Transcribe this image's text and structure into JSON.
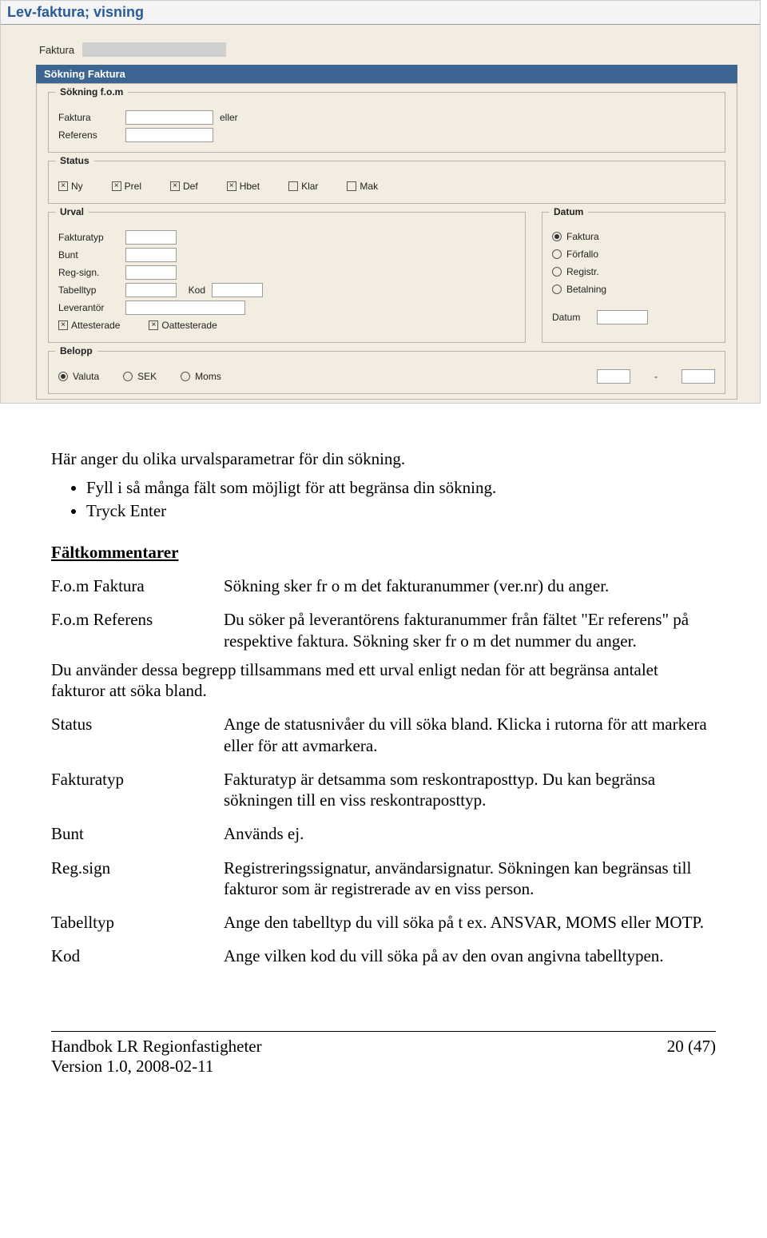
{
  "title_bar": "Lev-faktura; visning",
  "top": {
    "label": "Faktura"
  },
  "panel_title": "Sökning Faktura",
  "grp_fom": {
    "legend": "Sökning f.o.m",
    "faktura_label": "Faktura",
    "eller": "eller",
    "referens_label": "Referens"
  },
  "grp_status": {
    "legend": "Status",
    "items": [
      {
        "label": "Ny",
        "checked": true
      },
      {
        "label": "Prel",
        "checked": true
      },
      {
        "label": "Def",
        "checked": true
      },
      {
        "label": "Hbet",
        "checked": true
      },
      {
        "label": "Klar",
        "checked": false
      },
      {
        "label": "Mak",
        "checked": false
      }
    ]
  },
  "grp_urval": {
    "legend": "Urval",
    "fakturatyp": "Fakturatyp",
    "bunt": "Bunt",
    "regsign": "Reg-sign.",
    "tabelltyp": "Tabelltyp",
    "kod": "Kod",
    "leverantor": "Leverantör",
    "attesterade": {
      "label": "Attesterade",
      "checked": true
    },
    "oattesterade": {
      "label": "Oattesterade",
      "checked": true
    }
  },
  "grp_datum": {
    "legend": "Datum",
    "options": [
      {
        "label": "Faktura",
        "checked": true
      },
      {
        "label": "Förfallo",
        "checked": false
      },
      {
        "label": "Registr.",
        "checked": false
      },
      {
        "label": "Betalning",
        "checked": false
      }
    ],
    "datum_label": "Datum"
  },
  "grp_belopp": {
    "legend": "Belopp",
    "options": [
      {
        "label": "Valuta",
        "checked": true
      },
      {
        "label": "SEK",
        "checked": false
      },
      {
        "label": "Moms",
        "checked": false
      }
    ],
    "dash": "-"
  },
  "doc": {
    "intro": "Här anger du olika urvalsparametrar för din sökning.",
    "bullets": [
      "Fyll i så många fält som möjligt för att begränsa din sökning.",
      "Tryck Enter"
    ],
    "section": "Fältkommentarer",
    "rows1": [
      {
        "k": "F.o.m Faktura",
        "v": "Sökning sker fr o m det fakturanummer (ver.nr) du anger."
      },
      {
        "k": "F.o.m Referens",
        "v": "Du söker på leverantörens fakturanummer från fältet \"Er referens\" på respektive faktura. Sökning sker fr o m det nummer du anger."
      }
    ],
    "between": "Du använder dessa begrepp tillsammans med ett urval enligt nedan för att begränsa antalet fakturor att söka bland.",
    "rows2": [
      {
        "k": "Status",
        "v": "Ange de statusnivåer du vill söka bland. Klicka i rutorna för att markera eller för att avmarkera."
      },
      {
        "k": "Fakturatyp",
        "v": "Fakturatyp är detsamma som reskontraposttyp. Du kan begränsa sökningen till en viss reskontraposttyp."
      },
      {
        "k": "Bunt",
        "v": "Används ej."
      },
      {
        "k": "Reg.sign",
        "v": "Registreringssignatur, användarsignatur. Sökningen kan begränsas till fakturor som är registrerade av en viss person."
      },
      {
        "k": "Tabelltyp",
        "v": "Ange den tabelltyp du vill söka på t ex. ANSVAR, MOMS eller MOTP."
      },
      {
        "k": "Kod",
        "v": "Ange vilken kod du vill söka på av den ovan angivna tabelltypen."
      }
    ]
  },
  "footer": {
    "left1": "Handbok LR Regionfastigheter",
    "left2": "Version 1.0, 2008-02-11",
    "right": "20 (47)"
  }
}
